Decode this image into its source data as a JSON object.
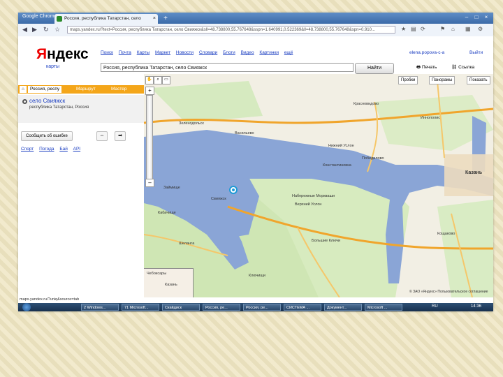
{
  "browser": {
    "label": "Google Chrome",
    "tab_title": "Россия, республика Татарстан, село",
    "url": "maps.yandex.ru/?text=Россия, республика Татарстан, село Свияжск&sll=48.738800,55.767648&sspn=1.640991,0.522369&ll=48.738800,55.767648&spn=0.910...",
    "window_controls": [
      "–",
      "□",
      "×"
    ]
  },
  "header": {
    "logo": "Яндекс",
    "logo_sub": "карты",
    "top_links": [
      "Поиск",
      "Почта",
      "Карты",
      "Маркет",
      "Новости",
      "Словари",
      "Блоги",
      "Видео",
      "Картинки",
      "ещё"
    ],
    "user": "elena.popova-c-a",
    "exit": "Выйти",
    "search_value": "Россия, республика Татарстан, село Свияжск",
    "search_button": "Найти",
    "print": "Печать",
    "link": "Ссылка"
  },
  "sidebar": {
    "tabs": [
      "Россия, респу",
      "Маршрут",
      "Мастер"
    ],
    "result_title": "село Свияжск",
    "result_subtitle": "республика Татарстан, Россия",
    "report_error": "Сообщить об ошибке",
    "links": [
      "Спорт",
      "Погода",
      "Бай",
      "API"
    ]
  },
  "map": {
    "toolbar": [
      "Пробки",
      "Панорамы",
      "Показать"
    ],
    "zoom_in": "+",
    "zoom_out": "–",
    "places": [
      "Казань",
      "Свияжск",
      "Васильево",
      "Зеленодольск",
      "Займище",
      "Кабачище",
      "Константиновка",
      "Верхний Услон",
      "Победилово",
      "Большие Ключи",
      "Нижний Услон",
      "Ключищи",
      "Шелангa",
      "Чебоксары",
      "Казань",
      "Красновидово",
      "Набережные Моркваши",
      "Иннополис",
      "Кощаково"
    ],
    "minimap_labels": [
      "Чебоксары",
      "Казань"
    ],
    "copyright": "© ЗАО «Яндекс» Пользовательское соглашение"
  },
  "status": {
    "url": "maps.yandex.ru/?uniq&source=tab"
  },
  "taskbar": {
    "tasks": [
      "2 Windows...",
      "71 Microsoft...",
      "Скайдиск",
      "Россия, ре...",
      "Россия, ре...",
      "СИСТЕМА ...",
      "Документ...",
      "Microsoft ..."
    ],
    "language": "RU",
    "time": "14:36"
  },
  "colors": {
    "water": "#8aa5d6",
    "forest": "#cfe6b4",
    "road_main": "#f0a52c",
    "accent_tab": "#f4a61a"
  }
}
